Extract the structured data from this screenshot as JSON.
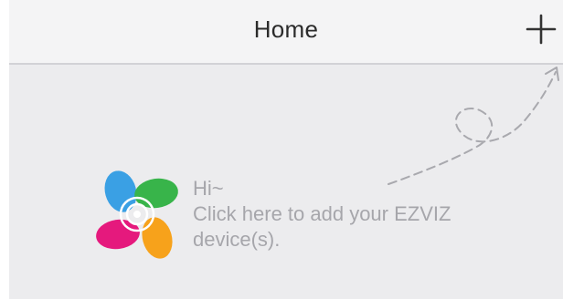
{
  "header": {
    "title": "Home",
    "add_icon": "plus-icon"
  },
  "empty_state": {
    "greeting": "Hi~",
    "line1": "Click here to add your EZVIZ",
    "line2": "device(s).",
    "logo": "ezviz-logo",
    "arrow_icon": "dashed-loop-arrow-icon"
  },
  "colors": {
    "header_bg": "#f4f4f5",
    "content_bg": "#ececee",
    "hint_text": "#a6a6ab",
    "logo_blue": "#3aa0e4",
    "logo_green": "#38b44a",
    "logo_pink": "#e5197d",
    "logo_orange": "#f7a21b"
  }
}
